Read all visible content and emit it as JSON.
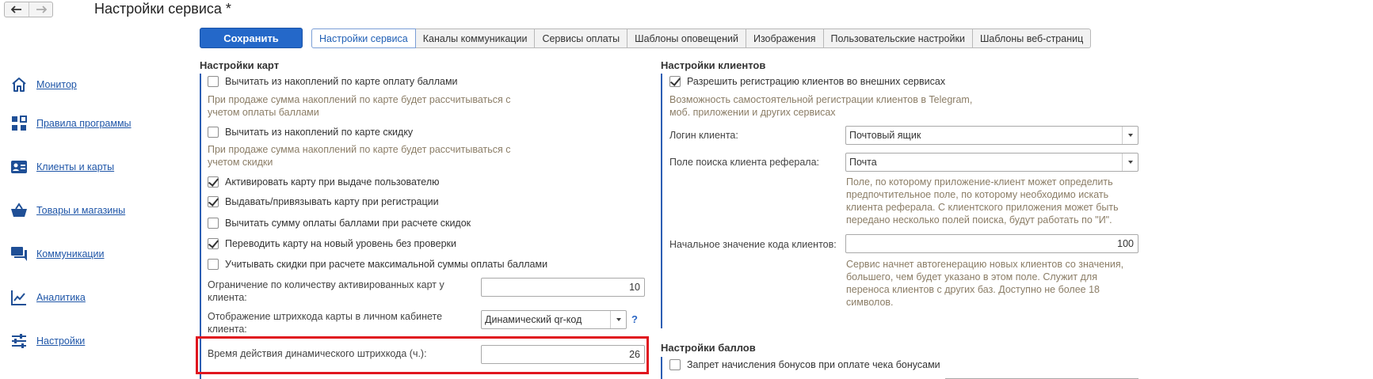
{
  "window": {
    "title": "Настройки сервиса *"
  },
  "toolbar": {
    "save_label": "Сохранить"
  },
  "tabs": [
    {
      "label": "Настройки сервиса",
      "active": true
    },
    {
      "label": "Каналы коммуникации"
    },
    {
      "label": "Сервисы оплаты"
    },
    {
      "label": "Шаблоны оповещений"
    },
    {
      "label": "Изображения"
    },
    {
      "label": "Пользовательские настройки"
    },
    {
      "label": "Шаблоны веб-страниц"
    }
  ],
  "sidebar": {
    "items": [
      {
        "label": "Монитор",
        "icon": "home-icon"
      },
      {
        "label": "Правила программы",
        "icon": "grid-icon"
      },
      {
        "label": "Клиенты и карты",
        "icon": "id-card-icon"
      },
      {
        "label": "Товары и магазины",
        "icon": "basket-icon"
      },
      {
        "label": "Коммуникации",
        "icon": "chat-icon"
      },
      {
        "label": "Аналитика",
        "icon": "chart-line-icon"
      },
      {
        "label": "Настройки",
        "icon": "sliders-icon"
      }
    ]
  },
  "cards": {
    "title": "Настройки карт",
    "deduct_points": {
      "label": "Вычитать из накоплений по карте оплату баллами",
      "checked": false
    },
    "deduct_points_hint": [
      "При продаже сумма накоплений по карте будет рассчитываться с",
      "учетом оплаты баллами"
    ],
    "deduct_discount": {
      "label": "Вычитать из накоплений по карте скидку",
      "checked": false
    },
    "deduct_discount_hint": [
      "При продаже сумма накоплений по карте будет рассчитываться с",
      "учетом скидки"
    ],
    "activate_on_issue": {
      "label": "Активировать карту при выдаче пользователю",
      "checked": true
    },
    "issue_on_register": {
      "label": "Выдавать/привязывать карту при регистрации",
      "checked": true
    },
    "deduct_sum_discount": {
      "label": "Вычитать сумму оплаты баллами при расчете скидок",
      "checked": false
    },
    "level_no_check": {
      "label": "Переводить карту на новый уровень без проверки",
      "checked": true
    },
    "consider_discounts": {
      "label": "Учитывать скидки при расчете максимальной суммы оплаты баллами",
      "checked": false
    },
    "limit_label": [
      "Ограничение по количеству активированных карт у",
      "клиента:"
    ],
    "limit_value": "10",
    "barcode_label": [
      "Отображение штрихкода карты в личном кабинете",
      "клиента:"
    ],
    "barcode_value": "Динамический qr-код",
    "help_label": "?",
    "dyn_label": "Время действия динамического штрихкода (ч.):",
    "dyn_value": "26"
  },
  "clients": {
    "title": "Настройки клиентов",
    "allow_ext": {
      "label": "Разрешить регистрацию клиентов во внешних сервисах",
      "checked": true
    },
    "allow_ext_hint": [
      "Возможность самостоятельной регистрации клиентов в Telegram,",
      "моб. приложении и других сервисах"
    ],
    "login_label": "Логин клиента:",
    "login_value": "Почтовый ящик",
    "ref_label": "Поле поиска клиента реферала:",
    "ref_value": "Почта",
    "ref_hint": [
      "Поле, по которому приложение-клиент может определить",
      "предпочтительное поле, по которому необходимо искать",
      "клиента реферала. С клиентского приложения может быть",
      "передано несколько полей поиска, будут работать по \"И\"."
    ],
    "code_label": "Начальное значение кода клиентов:",
    "code_value": "100",
    "code_hint": [
      "Сервис начнет автогенерацию новых клиентов со значения,",
      "большего, чем будет указано в этом поле. Служит для",
      "переноса клиентов с других баз. Доступно не более 18",
      "символов."
    ]
  },
  "points": {
    "title": "Настройки баллов",
    "forbid_bonus": {
      "label": "Запрет начисления бонусов при оплате чека бонусами",
      "checked": false
    }
  }
}
